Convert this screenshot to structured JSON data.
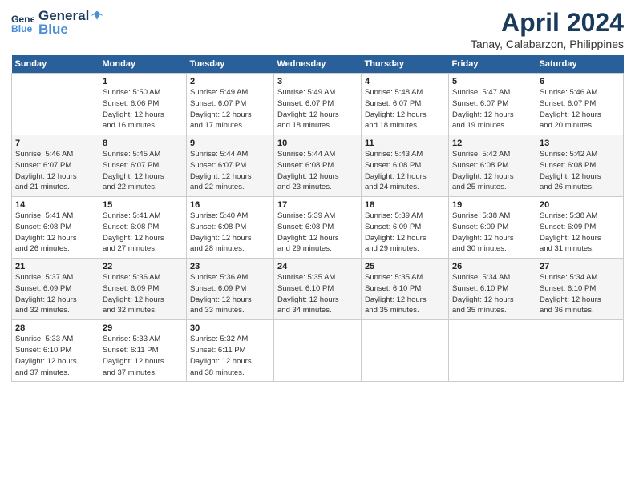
{
  "header": {
    "logo_line1": "General",
    "logo_line2": "Blue",
    "title": "April 2024",
    "subtitle": "Tanay, Calabarzon, Philippines"
  },
  "columns": [
    "Sunday",
    "Monday",
    "Tuesday",
    "Wednesday",
    "Thursday",
    "Friday",
    "Saturday"
  ],
  "weeks": [
    [
      {
        "day": "",
        "info": ""
      },
      {
        "day": "1",
        "info": "Sunrise: 5:50 AM\nSunset: 6:06 PM\nDaylight: 12 hours\nand 16 minutes."
      },
      {
        "day": "2",
        "info": "Sunrise: 5:49 AM\nSunset: 6:07 PM\nDaylight: 12 hours\nand 17 minutes."
      },
      {
        "day": "3",
        "info": "Sunrise: 5:49 AM\nSunset: 6:07 PM\nDaylight: 12 hours\nand 18 minutes."
      },
      {
        "day": "4",
        "info": "Sunrise: 5:48 AM\nSunset: 6:07 PM\nDaylight: 12 hours\nand 18 minutes."
      },
      {
        "day": "5",
        "info": "Sunrise: 5:47 AM\nSunset: 6:07 PM\nDaylight: 12 hours\nand 19 minutes."
      },
      {
        "day": "6",
        "info": "Sunrise: 5:46 AM\nSunset: 6:07 PM\nDaylight: 12 hours\nand 20 minutes."
      }
    ],
    [
      {
        "day": "7",
        "info": "Sunrise: 5:46 AM\nSunset: 6:07 PM\nDaylight: 12 hours\nand 21 minutes."
      },
      {
        "day": "8",
        "info": "Sunrise: 5:45 AM\nSunset: 6:07 PM\nDaylight: 12 hours\nand 22 minutes."
      },
      {
        "day": "9",
        "info": "Sunrise: 5:44 AM\nSunset: 6:07 PM\nDaylight: 12 hours\nand 22 minutes."
      },
      {
        "day": "10",
        "info": "Sunrise: 5:44 AM\nSunset: 6:08 PM\nDaylight: 12 hours\nand 23 minutes."
      },
      {
        "day": "11",
        "info": "Sunrise: 5:43 AM\nSunset: 6:08 PM\nDaylight: 12 hours\nand 24 minutes."
      },
      {
        "day": "12",
        "info": "Sunrise: 5:42 AM\nSunset: 6:08 PM\nDaylight: 12 hours\nand 25 minutes."
      },
      {
        "day": "13",
        "info": "Sunrise: 5:42 AM\nSunset: 6:08 PM\nDaylight: 12 hours\nand 26 minutes."
      }
    ],
    [
      {
        "day": "14",
        "info": "Sunrise: 5:41 AM\nSunset: 6:08 PM\nDaylight: 12 hours\nand 26 minutes."
      },
      {
        "day": "15",
        "info": "Sunrise: 5:41 AM\nSunset: 6:08 PM\nDaylight: 12 hours\nand 27 minutes."
      },
      {
        "day": "16",
        "info": "Sunrise: 5:40 AM\nSunset: 6:08 PM\nDaylight: 12 hours\nand 28 minutes."
      },
      {
        "day": "17",
        "info": "Sunrise: 5:39 AM\nSunset: 6:08 PM\nDaylight: 12 hours\nand 29 minutes."
      },
      {
        "day": "18",
        "info": "Sunrise: 5:39 AM\nSunset: 6:09 PM\nDaylight: 12 hours\nand 29 minutes."
      },
      {
        "day": "19",
        "info": "Sunrise: 5:38 AM\nSunset: 6:09 PM\nDaylight: 12 hours\nand 30 minutes."
      },
      {
        "day": "20",
        "info": "Sunrise: 5:38 AM\nSunset: 6:09 PM\nDaylight: 12 hours\nand 31 minutes."
      }
    ],
    [
      {
        "day": "21",
        "info": "Sunrise: 5:37 AM\nSunset: 6:09 PM\nDaylight: 12 hours\nand 32 minutes."
      },
      {
        "day": "22",
        "info": "Sunrise: 5:36 AM\nSunset: 6:09 PM\nDaylight: 12 hours\nand 32 minutes."
      },
      {
        "day": "23",
        "info": "Sunrise: 5:36 AM\nSunset: 6:09 PM\nDaylight: 12 hours\nand 33 minutes."
      },
      {
        "day": "24",
        "info": "Sunrise: 5:35 AM\nSunset: 6:10 PM\nDaylight: 12 hours\nand 34 minutes."
      },
      {
        "day": "25",
        "info": "Sunrise: 5:35 AM\nSunset: 6:10 PM\nDaylight: 12 hours\nand 35 minutes."
      },
      {
        "day": "26",
        "info": "Sunrise: 5:34 AM\nSunset: 6:10 PM\nDaylight: 12 hours\nand 35 minutes."
      },
      {
        "day": "27",
        "info": "Sunrise: 5:34 AM\nSunset: 6:10 PM\nDaylight: 12 hours\nand 36 minutes."
      }
    ],
    [
      {
        "day": "28",
        "info": "Sunrise: 5:33 AM\nSunset: 6:10 PM\nDaylight: 12 hours\nand 37 minutes."
      },
      {
        "day": "29",
        "info": "Sunrise: 5:33 AM\nSunset: 6:11 PM\nDaylight: 12 hours\nand 37 minutes."
      },
      {
        "day": "30",
        "info": "Sunrise: 5:32 AM\nSunset: 6:11 PM\nDaylight: 12 hours\nand 38 minutes."
      },
      {
        "day": "",
        "info": ""
      },
      {
        "day": "",
        "info": ""
      },
      {
        "day": "",
        "info": ""
      },
      {
        "day": "",
        "info": ""
      }
    ]
  ]
}
